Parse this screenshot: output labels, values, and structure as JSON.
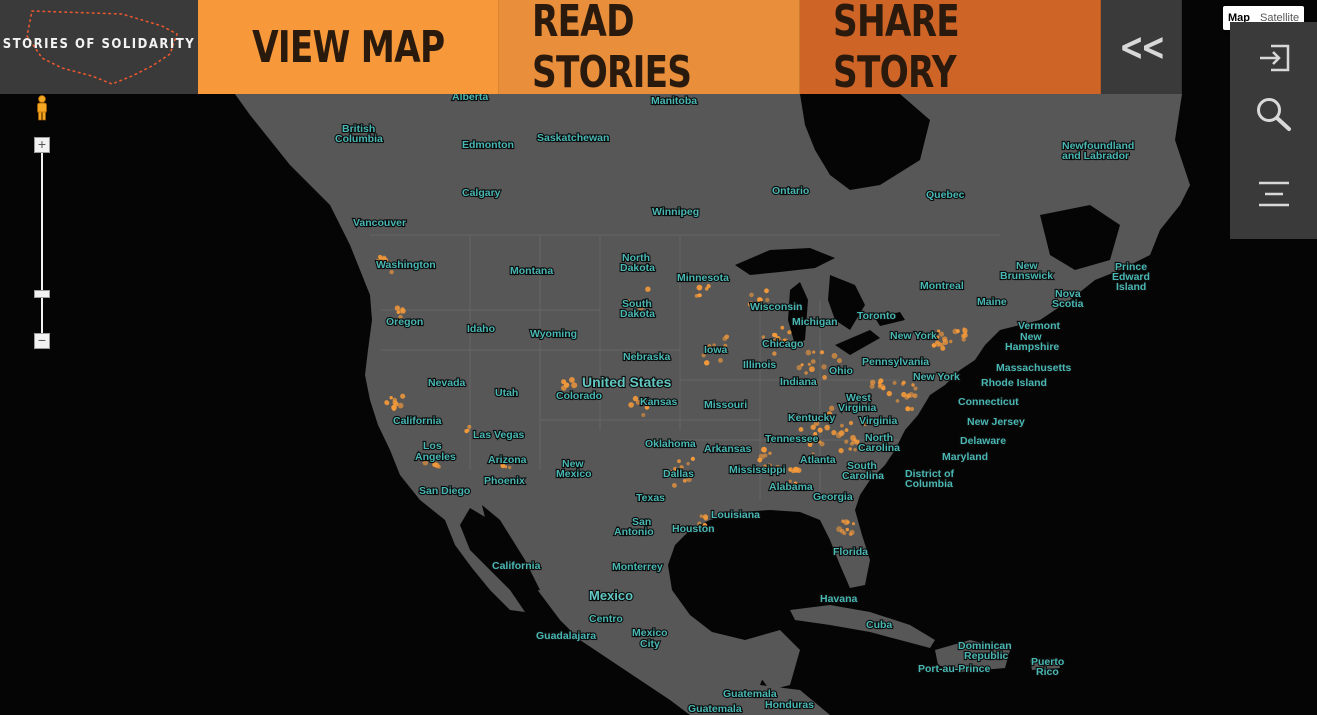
{
  "brand": {
    "name": "STORIES OF SOLIDARITY"
  },
  "nav": {
    "view_map": "VIEW MAP",
    "read_stories": "READ STORIES",
    "share_story": "SHARE STORY",
    "collapse": "<<"
  },
  "map_type": {
    "map": "Map",
    "satellite": "Satellite"
  },
  "side_panel": {
    "icons": [
      "login-icon",
      "search-icon",
      "menu-icon"
    ]
  },
  "colors": {
    "view_map": "#f7993a",
    "read_stories": "#e98e3a",
    "share_story": "#cf6427",
    "panel": "#3a3a3a",
    "land": "#555555",
    "water": "#050505",
    "label": "#49b8b4",
    "marker": "#f59a3a"
  },
  "map_labels": {
    "alberta": "Alberta",
    "manitoba": "Manitoba",
    "british_columbia_1": "British",
    "british_columbia_2": "Columbia",
    "edmonton": "Edmonton",
    "saskatchewan": "Saskatchewan",
    "newfoundland_1": "Newfoundland",
    "newfoundland_2": "and Labrador",
    "calgary": "Calgary",
    "ontario": "Ontario",
    "quebec": "Quebec",
    "winnipeg": "Winnipeg",
    "vancouver": "Vancouver",
    "washington": "Washington",
    "montana": "Montana",
    "north_dakota_1": "North",
    "north_dakota_2": "Dakota",
    "minnesota": "Minnesota",
    "new_brunswick_1": "New",
    "new_brunswick_2": "Brunswick",
    "pei_1": "Prince",
    "pei_2": "Edward",
    "pei_3": "Island",
    "montreal": "Montreal",
    "nova_scotia_1": "Nova",
    "nova_scotia_2": "Scotia",
    "maine": "Maine",
    "south_dakota_1": "South",
    "south_dakota_2": "Dakota",
    "wisconsin": "Wisconsin",
    "oregon": "Oregon",
    "idaho": "Idaho",
    "wyoming": "Wyoming",
    "michigan": "Michigan",
    "toronto": "Toronto",
    "vermont": "Vermont",
    "new_york": "New York",
    "new_hampshire_1": "New",
    "new_hampshire_2": "Hampshire",
    "chicago": "Chicago",
    "iowa": "Iowa",
    "nebraska": "Nebraska",
    "pennsylvania": "Pennsylvania",
    "massachusetts": "Massachusetts",
    "illinois": "Illinois",
    "ohio": "Ohio",
    "nevada": "Nevada",
    "utah": "Utah",
    "united_states": "United States",
    "new_york_city": "New York",
    "rhode_island": "Rhode Island",
    "colorado": "Colorado",
    "indiana": "Indiana",
    "west_virginia_1": "West",
    "west_virginia_2": "Virginia",
    "connecticut": "Connecticut",
    "california": "California",
    "kansas": "Kansas",
    "missouri": "Missouri",
    "virginia": "Virginia",
    "new_jersey": "New Jersey",
    "kentucky": "Kentucky",
    "las_vegas": "Las Vegas",
    "los_angeles_1": "Los",
    "los_angeles_2": "Angeles",
    "oklahoma": "Oklahoma",
    "tennessee": "Tennessee",
    "north_carolina_1": "North",
    "north_carolina_2": "Carolina",
    "delaware": "Delaware",
    "arizona": "Arizona",
    "arkansas": "Arkansas",
    "atlanta": "Atlanta",
    "new_mexico_1": "New",
    "new_mexico_2": "Mexico",
    "maryland": "Maryland",
    "phoenix": "Phoenix",
    "dallas": "Dallas",
    "mississippi": "Mississippi",
    "south_carolina_1": "South",
    "south_carolina_2": "Carolina",
    "dc_1": "District of",
    "dc_2": "Columbia",
    "san_diego": "San Diego",
    "alabama": "Alabama",
    "texas": "Texas",
    "georgia": "Georgia",
    "louisiana": "Louisiana",
    "san_antonio_1": "San",
    "san_antonio_2": "Antonio",
    "houston": "Houston",
    "florida": "Florida",
    "california_baja": "California",
    "monterrey": "Monterrey",
    "havana": "Havana",
    "mexico": "Mexico",
    "cuba": "Cuba",
    "centro": "Centro",
    "guadalajara": "Guadalajara",
    "mexico_city_1": "Mexico",
    "mexico_city_2": "City",
    "dominican_1": "Dominican",
    "dominican_2": "Republic",
    "port_au_prince": "Port-au-Prince",
    "puerto_rico_1": "Puerto",
    "puerto_rico_2": "Rico",
    "guatemala": "Guatemala",
    "guatemala_city": "Guatemala",
    "honduras": "Honduras"
  }
}
